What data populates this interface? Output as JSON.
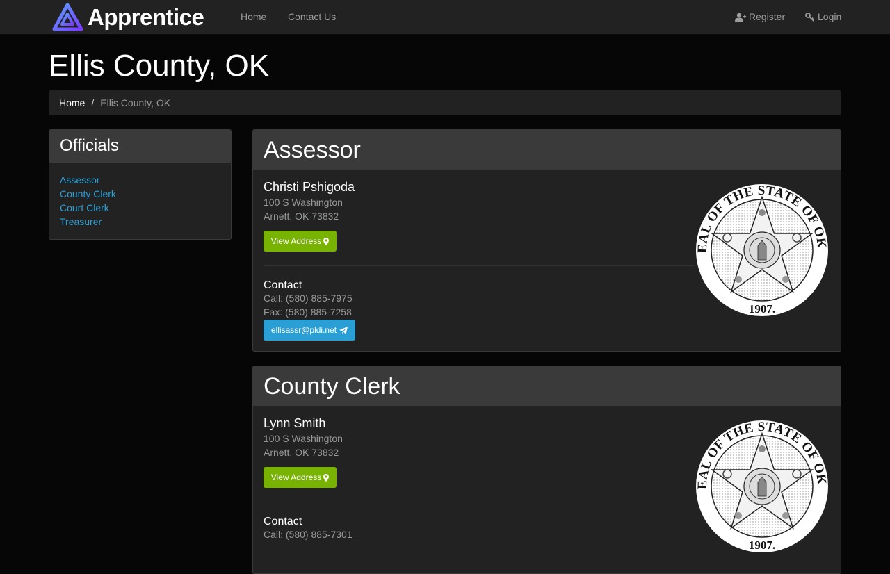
{
  "navbar": {
    "brand": "Apprentice",
    "links": [
      "Home",
      "Contact Us"
    ],
    "register": "Register",
    "login": "Login"
  },
  "page": {
    "title": "Ellis County, OK"
  },
  "breadcrumb": {
    "home": "Home",
    "separator": "/",
    "current": "Ellis County, OK"
  },
  "sidebar": {
    "title": "Officials",
    "items": [
      "Assessor",
      "County Clerk",
      "Court Clerk",
      "Treasurer"
    ]
  },
  "officials": [
    {
      "office": "Assessor",
      "name": "Christi Pshigoda",
      "address_line1": "100 S Washington",
      "address_line2": "Arnett, OK 73832",
      "view_address_label": "View Address",
      "contact_title": "Contact",
      "call": "Call: (580) 885-7975",
      "fax": "Fax: (580) 885-7258",
      "email": "ellisassr@pldi.net"
    },
    {
      "office": "County Clerk",
      "name": "Lynn Smith",
      "address_line1": "100 S Washington",
      "address_line2": "Arnett, OK 73832",
      "view_address_label": "View Address",
      "contact_title": "Contact",
      "call": "Call: (580) 885-7301"
    }
  ],
  "seal": {
    "top_text": "GREAT SEAL OF THE STATE OF OKLAHOMA",
    "year": "1907."
  },
  "colors": {
    "accent_blue": "#2a9fd6",
    "accent_green": "#77b300",
    "navbar": "#222222",
    "panel_head": "#3a3a3a"
  },
  "icons": {
    "brand": "apprentice-logo-icon",
    "register": "user-plus-icon",
    "login": "key-icon",
    "address": "map-marker-icon",
    "email": "paper-plane-icon",
    "seal": "oklahoma-seal-icon"
  }
}
